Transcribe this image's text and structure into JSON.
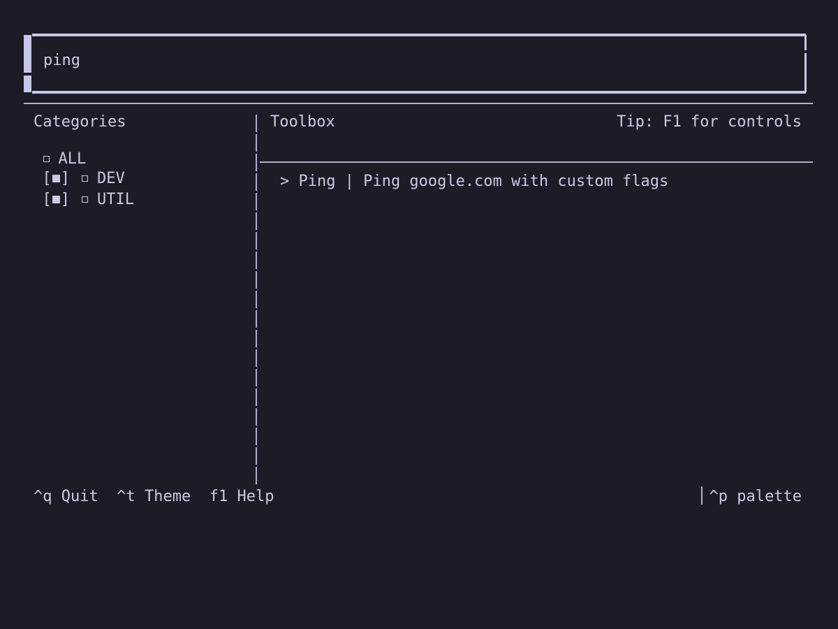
{
  "search": {
    "value": "ping"
  },
  "categories": {
    "title": "Categories",
    "items": [
      {
        "label": "ALL",
        "checked": null
      },
      {
        "label": "DEV",
        "checked": true
      },
      {
        "label": "UTIL",
        "checked": true
      }
    ]
  },
  "toolbox": {
    "title": "Toolbox",
    "tip": "Tip: F1 for controls",
    "tools": [
      {
        "text": "> Ping | Ping google.com with custom flags"
      }
    ]
  },
  "footer": {
    "shortcuts": [
      {
        "key": "^q",
        "label": "Quit"
      },
      {
        "key": "^t",
        "label": "Theme"
      },
      {
        "key": "f1",
        "label": "Help"
      }
    ],
    "palette": {
      "key": "^p",
      "label": "palette"
    }
  },
  "colors": {
    "background": "#1b1c26",
    "foreground": "#c9cbe4",
    "border": "#c6c7ea"
  }
}
